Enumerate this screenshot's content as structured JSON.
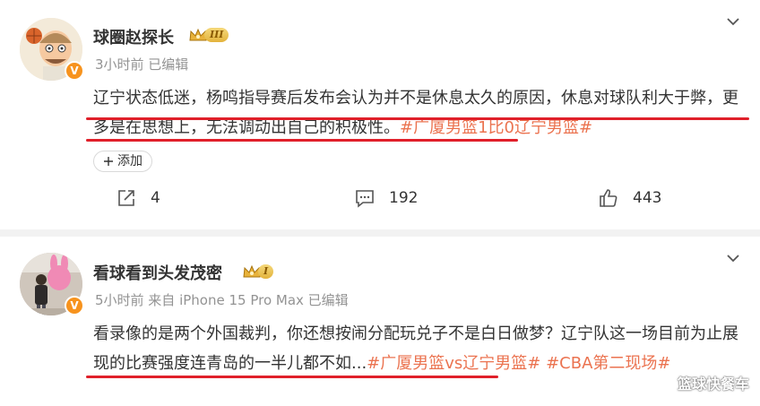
{
  "posts": [
    {
      "author": "球圈赵探长",
      "rank_level": "III",
      "meta": "3小时前   已编辑",
      "content_plain": "辽宁状态低迷，杨鸣指导赛后发布会认为并不是休息太久的原因，休息对球队利大于弊，更多是在思想上，无法调动出自己的积极性。",
      "content_tag": "#广厦男篮1比0辽宁男篮#",
      "add_label": "添加",
      "share_count": "4",
      "comment_count": "192",
      "like_count": "443"
    },
    {
      "author": "看球看到头发茂密",
      "rank_level": "I",
      "meta": "5小时前 来自 iPhone 15 Pro Max 已编辑",
      "content_plain": "看录像的是两个外国裁判，你还想按闹分配玩兑子不是白日做梦？辽宁队这一场目前为止展现的比赛强度连青岛的一半儿都不如...",
      "content_tags": "#广厦男篮vs辽宁男篮# #CBA第二现场#"
    }
  ],
  "watermark": "篮球快餐车",
  "colors": {
    "tag": "#eb7350",
    "underline": "#e0202a",
    "verified_badge": "#f7931e",
    "meta": "#939393"
  },
  "icons": [
    "more-chevron-icon",
    "crown-icon",
    "verified-v-icon",
    "plus-icon",
    "share-icon",
    "comment-icon",
    "like-icon"
  ]
}
